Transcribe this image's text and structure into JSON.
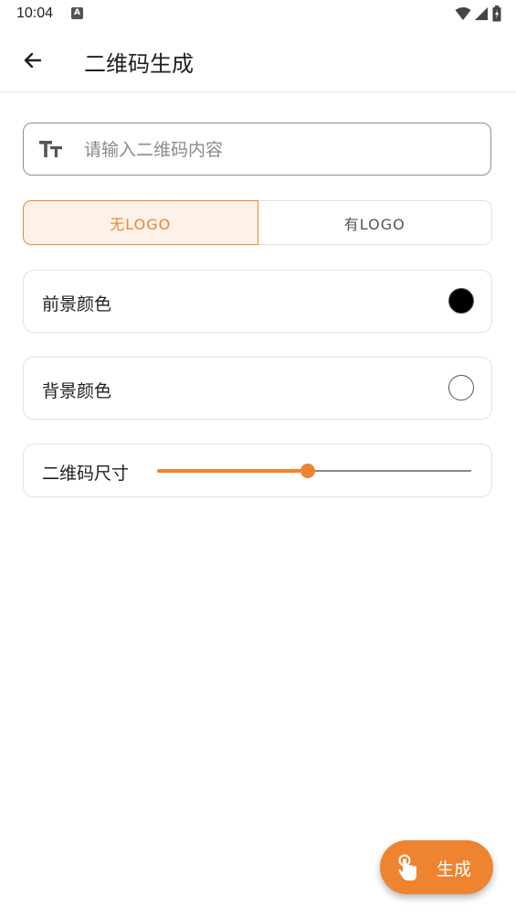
{
  "status": {
    "time": "10:04",
    "indicator": "A"
  },
  "appbar": {
    "back_icon": "arrow-left-icon",
    "title": "二维码生成"
  },
  "input": {
    "icon": "text-size-icon",
    "placeholder": "请输入二维码内容",
    "value": ""
  },
  "logo_toggle": {
    "options": [
      "无LOGO",
      "有LOGO"
    ],
    "selected": "无LOGO"
  },
  "foreground": {
    "label": "前景颜色",
    "color": "#000000"
  },
  "background": {
    "label": "背景颜色",
    "color": "#ffffff"
  },
  "size": {
    "label": "二维码尺寸",
    "slider_fraction": 0.48
  },
  "fab": {
    "icon": "touch-hand-icon",
    "label": "生成"
  },
  "colors": {
    "accent": "#ee842f",
    "accent_light": "#fdf2ea"
  }
}
